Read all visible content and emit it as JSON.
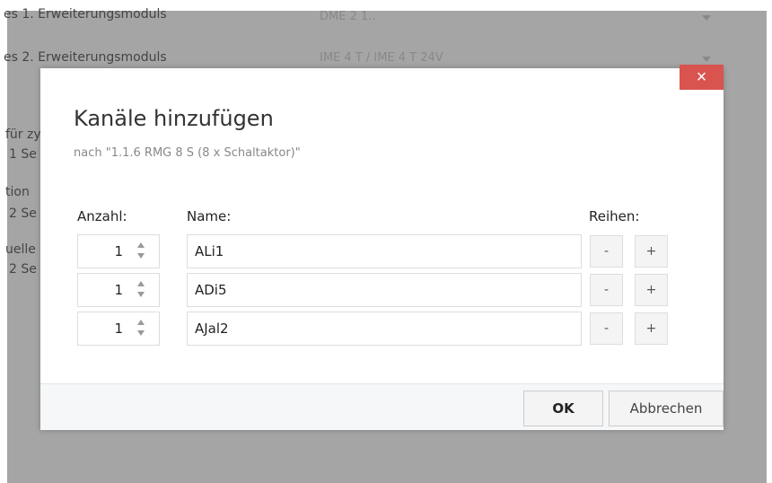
{
  "background": {
    "rows": [
      {
        "label": "es 1. Erweiterungsmoduls",
        "dropdown": "DME 2 1.."
      },
      {
        "label": "es 2. Erweiterungsmoduls",
        "dropdown": "IME 4 T / IME 4 T 24V"
      }
    ],
    "side_fragments": [
      "für zy",
      "1 Se",
      "tion",
      "2 Se",
      "uelle",
      "2 Se"
    ]
  },
  "dialog": {
    "close_label": "×",
    "title": "Kanäle hinzufügen",
    "subtitle": "nach \"1.1.6 RMG 8 S (8 x Schaltaktor)\"",
    "headers": {
      "count": "Anzahl:",
      "name": "Name:",
      "rows": "Reihen:"
    },
    "rows": [
      {
        "count": "1",
        "name": "ALi1",
        "minus": "-",
        "plus": "+"
      },
      {
        "count": "1",
        "name": "ADi5",
        "minus": "-",
        "plus": "+"
      },
      {
        "count": "1",
        "name": "AJal2",
        "minus": "-",
        "plus": "+"
      }
    ],
    "ok_label": "OK",
    "cancel_label": "Abbrechen"
  },
  "colors": {
    "close_button": "#d9534f",
    "overlay": "#a5a5a5",
    "footer": "#f5f7f9"
  }
}
